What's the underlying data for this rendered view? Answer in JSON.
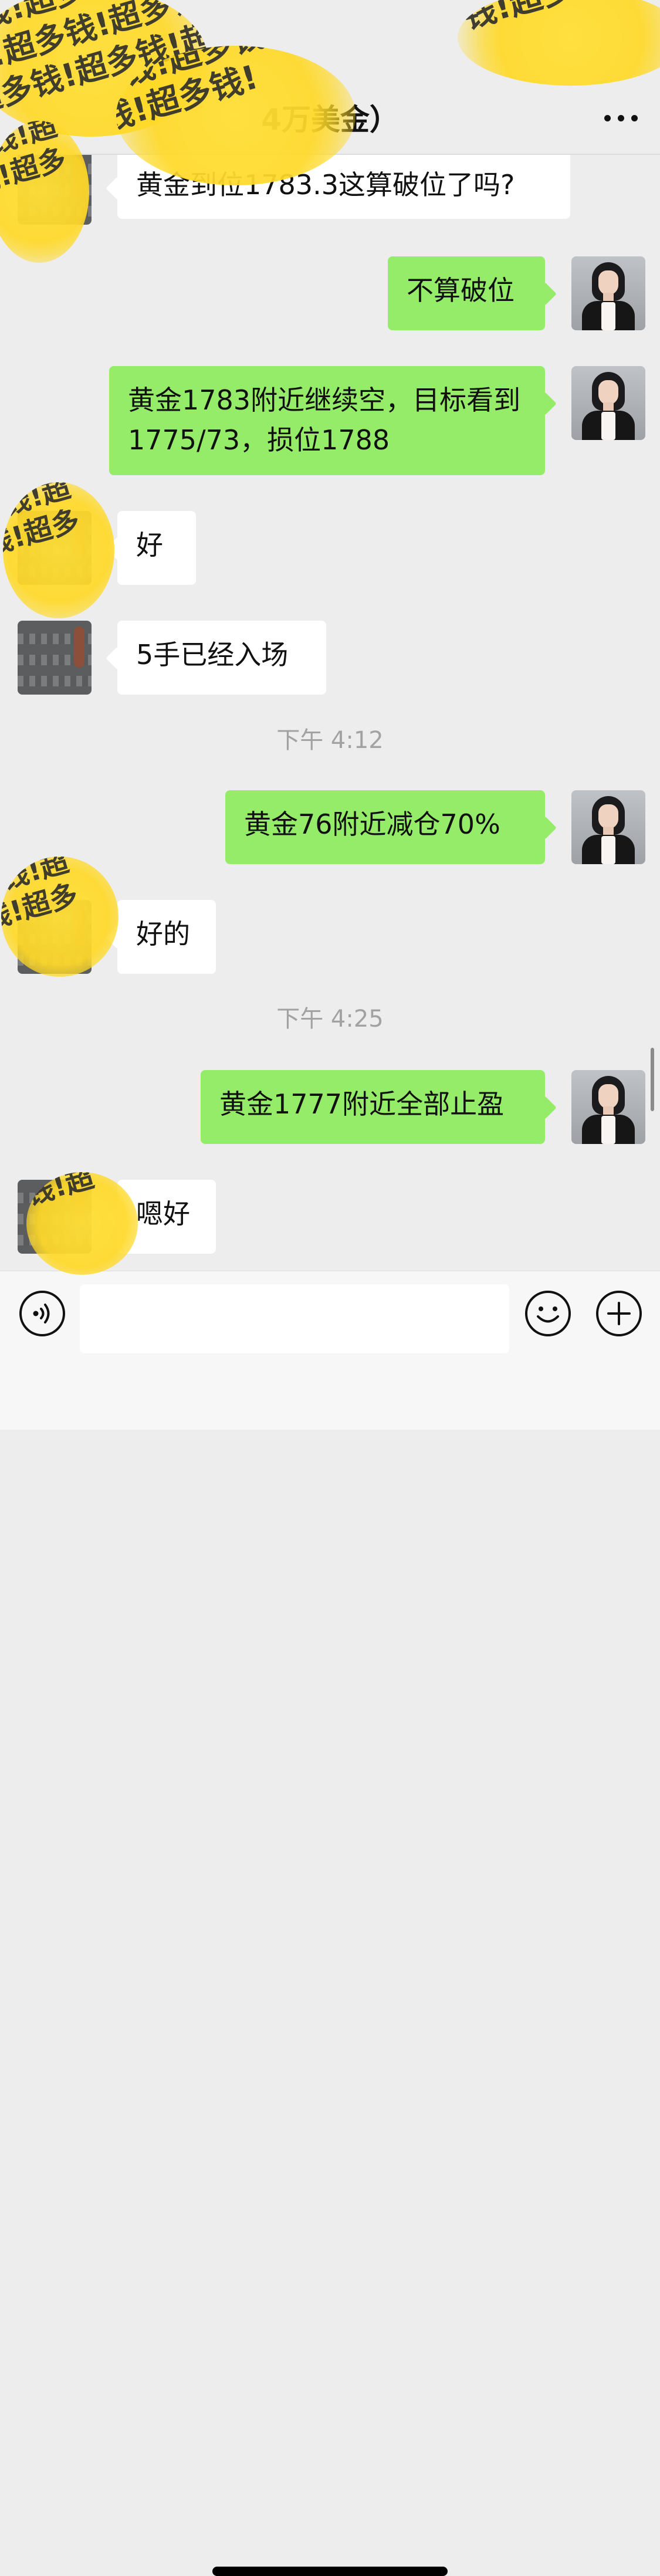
{
  "header": {
    "title": "4万美金）"
  },
  "colors": {
    "background": "#ededed",
    "sent_bubble": "#95ec69",
    "received_bubble": "#ffffff",
    "overlay": "#ffd92b"
  },
  "messages": [
    {
      "text": "黄金到位1783.3这算破位了吗?"
    },
    {
      "text": "不算破位"
    },
    {
      "text": "黄金1783附近继续空，目标看到1775/73，损位1788"
    },
    {
      "text": "好"
    },
    {
      "text": "5手已经入场"
    },
    {
      "text": "下午 4:12"
    },
    {
      "text": "黄金76附近减仓70%"
    },
    {
      "text": "好的"
    },
    {
      "text": "下午 4:25"
    },
    {
      "text": "黄金1777附近全部止盈"
    },
    {
      "text": "嗯好"
    }
  ],
  "composer": {
    "value": ""
  },
  "overlays": [
    {
      "text": "超多钱!超多钱!超多钱!\n多钱!超多钱!超多钱!\n钱!超多钱!超多钱!\n超多钱!超多钱!超多钱!"
    },
    {
      "text": "超多钱!超多钱!\n多钱!超多钱!\n钱!超多钱!"
    },
    {
      "text": "超多钱!超多钱!\n多钱!超多钱!"
    },
    {
      "text": "超多钱!\n多钱!超\n钱!超多"
    },
    {
      "text": "超多钱!\n多钱!超\n钱!超多"
    },
    {
      "text": "超多钱!\n多钱!超\n钱!超多"
    },
    {
      "text": "超多钱!\n多钱!超"
    }
  ]
}
